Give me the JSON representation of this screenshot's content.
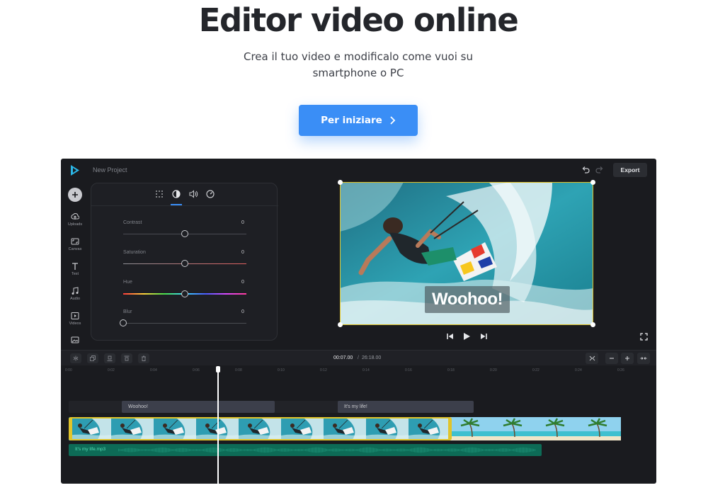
{
  "hero": {
    "title": "Editor video online",
    "subtitle_line1": "Crea il tuo video e modificalo come vuoi su",
    "subtitle_line2": "smartphone o PC",
    "cta_label": "Per iniziare"
  },
  "editor": {
    "project_name": "New Project",
    "export_label": "Export",
    "nav": [
      {
        "label": "Uploads",
        "icon": "upload-icon"
      },
      {
        "label": "Canvas",
        "icon": "canvas-icon"
      },
      {
        "label": "Text",
        "icon": "text-icon"
      },
      {
        "label": "Audio",
        "icon": "music-icon"
      },
      {
        "label": "Videos",
        "icon": "video-icon"
      },
      {
        "label": "",
        "icon": "image-icon"
      }
    ],
    "panel_tabs": [
      "grid-icon",
      "contrast-icon",
      "volume-icon",
      "speed-icon"
    ],
    "adjustments": [
      {
        "label": "Contrast",
        "value": "0",
        "level": 0.5
      },
      {
        "label": "Saturation",
        "value": "0",
        "level": 0.5
      },
      {
        "label": "Hue",
        "value": "0",
        "level": 0.5
      },
      {
        "label": "Blur",
        "value": "0",
        "level": 0
      }
    ],
    "preview_caption": "Woohoo!",
    "time_current": "00:07.00",
    "time_separator": "/",
    "time_total": "26:18.00",
    "ruler_ticks": [
      "0:00",
      "0:02",
      "0:04",
      "0:06",
      "0:08",
      "0:10",
      "0:12",
      "0:14",
      "0:16",
      "0:18",
      "0:20",
      "0:22",
      "0:24",
      "0:26"
    ],
    "text_clips": [
      "Woohoo!",
      "It's my life!"
    ],
    "audio_clip": "It's my life.mp3",
    "colors": {
      "accent": "#3a8ef6",
      "selection": "#e1c42a",
      "audio": "#0d6b56",
      "background": "#1a1b1f"
    }
  }
}
